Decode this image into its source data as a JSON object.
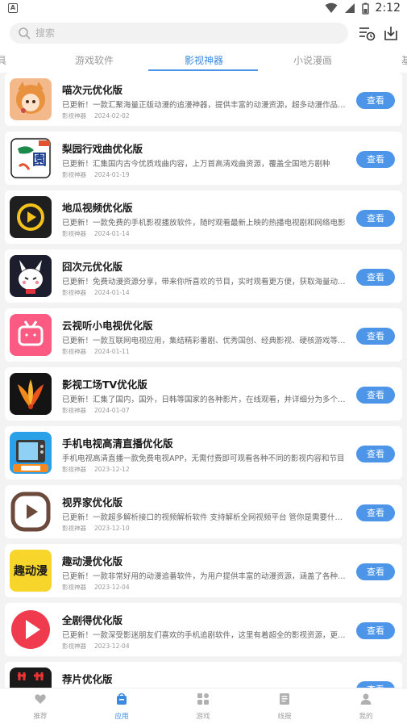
{
  "status_bar": {
    "time": "2:12"
  },
  "search": {
    "placeholder": "搜索"
  },
  "tabs": [
    {
      "label": "具"
    },
    {
      "label": "游戏软件"
    },
    {
      "label": "影视神器"
    },
    {
      "label": "小说漫画"
    },
    {
      "label": "基"
    }
  ],
  "apps": [
    {
      "name": "喵次元优化版",
      "desc": "已更新！一款汇聚海量正版动漫的追漫神器，提供丰富的动漫资源，超多动漫作品任你选择",
      "category": "影视神器",
      "date": "2024-02-02",
      "button": "查看",
      "icon": "anime-girl-icon"
    },
    {
      "name": "梨园行戏曲优化版",
      "desc": "已更新！汇集国内古今优质戏曲内容，上万首高清戏曲资源，覆盖全国地方剧种",
      "category": "影视神器",
      "date": "2024-01-19",
      "button": "查看",
      "icon": "opera-icon"
    },
    {
      "name": "地瓜视频优化版",
      "desc": "已更新！一款免费的手机影视播放软件，随时观看最新上映的热播电视剧和网络电影",
      "category": "影视神器",
      "date": "2024-01-14",
      "button": "查看",
      "icon": "play-circle-icon"
    },
    {
      "name": "囧次元优化版",
      "desc": "已更新！免费动漫资源分享，带来你所喜欢的节目，实时观看更方便，获取海量动漫资源",
      "category": "影视神器",
      "date": "2024-01-14",
      "button": "查看",
      "icon": "mascot-icon"
    },
    {
      "name": "云视听小电视优化版",
      "desc": "已更新！一款互联网电视应用，集结精彩番剧、优秀国创、经典影视、硬核游戏等内容",
      "category": "影视神器",
      "date": "2024-01-11",
      "button": "查看",
      "icon": "tv-icon"
    },
    {
      "name": "影视工场TV优化版",
      "desc": "已更新！汇集了国内，国外，日韩等国家的各种影片，在线观看，并详细分为多个类别",
      "category": "影视神器",
      "date": "2024-01-07",
      "button": "查看",
      "icon": "bird-icon"
    },
    {
      "name": "手机电视高清直播优化版",
      "desc": "手机电视高清直播一款免费电视APP，无需付费即可观看各种不同的影视内容和节目",
      "category": "影视神器",
      "date": "2023-12-12",
      "button": "查看",
      "icon": "retro-tv-icon"
    },
    {
      "name": "视界家优化版",
      "desc": "已更新！一款超多解析接口的视频解析软件 支持解析全网视频平台 管你是需要什么视频",
      "category": "影视神器",
      "date": "2023-12-10",
      "button": "查看",
      "icon": "play-outline-icon"
    },
    {
      "name": "趣动漫优化版",
      "desc": "已更新！一款非常好用的动漫追番软件，为用户提供丰富的动漫资源，涵盖了各种类型",
      "category": "影视神器",
      "date": "2023-12-04",
      "button": "查看",
      "icon": "qu-dongman-icon",
      "icon_text": "趣动漫"
    },
    {
      "name": "全剧得优化版",
      "desc": "已更新！一款深受影迷朋友们喜欢的手机追剧软件，这里有着超全的影视资源，更新及时",
      "category": "影视神器",
      "date": "2023-12-04",
      "button": "查看",
      "icon": "red-play-icon"
    },
    {
      "name": "荐片优化版",
      "desc": "",
      "category": "",
      "date": "",
      "button": "查看",
      "icon": "jianpian-icon"
    }
  ],
  "bottom_nav": [
    {
      "label": "推荐",
      "icon": "heart-icon"
    },
    {
      "label": "应用",
      "icon": "bag-icon"
    },
    {
      "label": "游戏",
      "icon": "grid-icon"
    },
    {
      "label": "线报",
      "icon": "doc-icon"
    },
    {
      "label": "我的",
      "icon": "user-icon"
    }
  ],
  "colors": {
    "accent": "#4d95e8",
    "background": "#f3f3f3"
  }
}
